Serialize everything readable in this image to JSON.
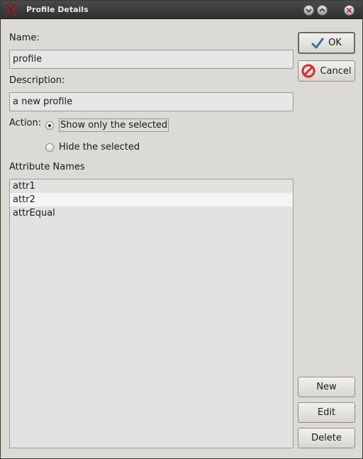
{
  "window": {
    "title": "Profile Details"
  },
  "form": {
    "name_label": "Name:",
    "name_value": "profile",
    "description_label": "Description:",
    "description_value": "a new profile",
    "action_label": "Action:",
    "action_options": [
      {
        "label": "Show only the selected",
        "selected": true
      },
      {
        "label": "Hide the selected",
        "selected": false
      }
    ],
    "attributes_label": "Attribute Names",
    "attributes": [
      "attr1",
      "attr2",
      "attrEqual"
    ]
  },
  "buttons": {
    "ok": "OK",
    "cancel": "Cancel",
    "new": "New",
    "edit": "Edit",
    "delete": "Delete"
  },
  "icons": {
    "ok": "checkmark-icon",
    "cancel": "no-entry-icon"
  },
  "colors": {
    "window_bg": "#dcdad5",
    "titlebar": "#3a3a3a",
    "ok_check": "#3c6ea8",
    "cancel_red": "#d02c2c"
  }
}
